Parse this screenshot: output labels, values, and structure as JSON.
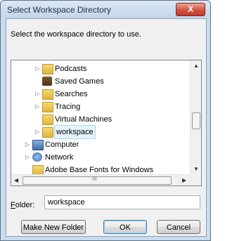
{
  "window": {
    "title": "Select Workspace Directory",
    "close_label": "X"
  },
  "prompt": "Select the workspace directory to use.",
  "tree": {
    "items": [
      {
        "label": "Podcasts",
        "icon": "folder-icon",
        "expander": "▷"
      },
      {
        "label": "Saved Games",
        "icon": "saved-games-icon",
        "expander": ""
      },
      {
        "label": "Searches",
        "icon": "search-folder-icon",
        "expander": "▷"
      },
      {
        "label": "Tracing",
        "icon": "folder-icon",
        "expander": "▷"
      },
      {
        "label": "Virtual Machines",
        "icon": "folder-icon",
        "expander": ""
      },
      {
        "label": "workspace",
        "icon": "folder-icon",
        "expander": "▷",
        "selected": true
      },
      {
        "label": "Computer",
        "icon": "computer-icon",
        "expander": "▷"
      },
      {
        "label": "Network",
        "icon": "network-icon",
        "expander": "▷"
      },
      {
        "label": "Adobe Base Fonts for Windows",
        "icon": "folder-icon",
        "expander": ""
      }
    ],
    "hscroll_thumb_label": "III"
  },
  "folder": {
    "label_accel": "F",
    "label_rest": "older:",
    "value": "workspace"
  },
  "buttons": {
    "make_new_folder": "Make New Folder",
    "ok": "OK",
    "cancel": "Cancel"
  }
}
